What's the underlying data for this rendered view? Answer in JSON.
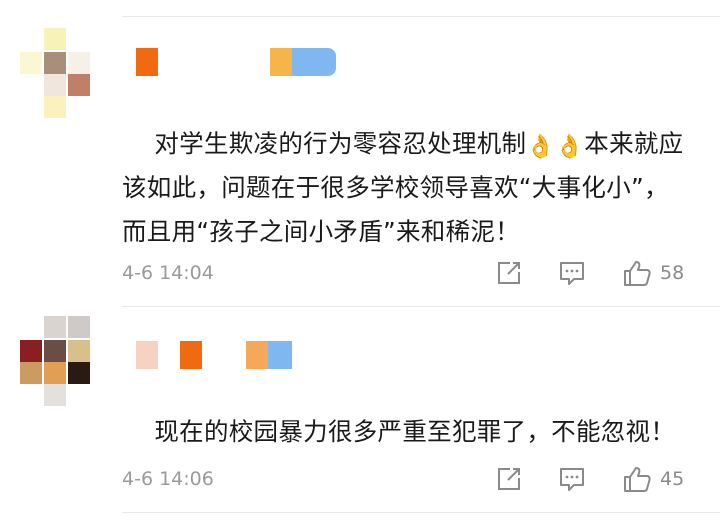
{
  "comments": [
    {
      "text_before_emoji": "对学生欺凌的行为零容忍处理机制",
      "emojis": [
        "👌",
        "👌"
      ],
      "text_after_emoji": "本来就应该如此，问题在于很多学校领导喜欢“大事化小”，而且用“孩子之间小矛盾”来和稀泥！",
      "time": "4-6 14:04",
      "likes": "58"
    },
    {
      "text_before_emoji": "现在的校园暴力很多严重至犯罪了，不能忽视！",
      "emojis": [],
      "text_after_emoji": "",
      "time": "4-6 14:06",
      "likes": "45"
    }
  ],
  "icons": {
    "share": "share-icon",
    "reply": "comment-icon",
    "like": "thumbs-up-icon"
  },
  "colors": {
    "text": "#1a1a1a",
    "meta": "#9a9a9a",
    "icon": "#8a8a8a",
    "divider": "#e9e9e9"
  }
}
